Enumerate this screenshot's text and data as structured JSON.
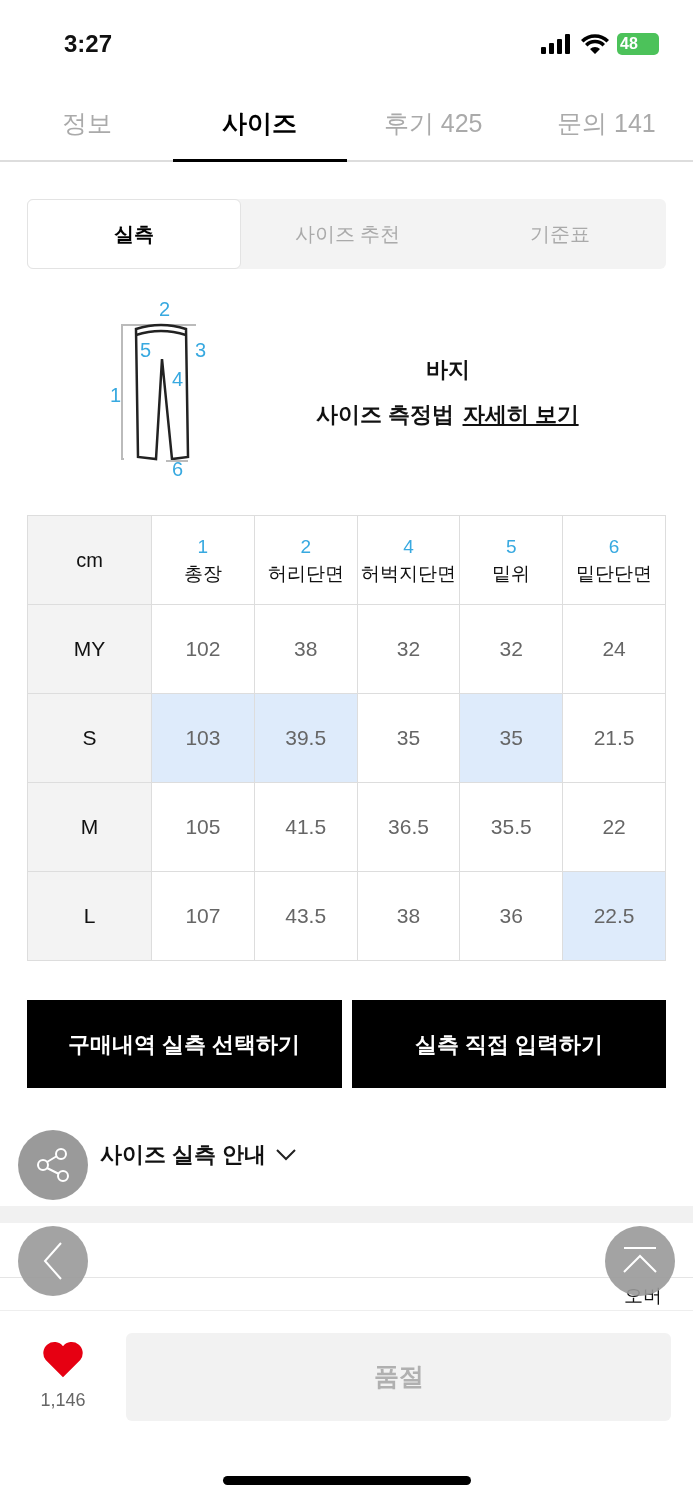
{
  "status_bar": {
    "time": "3:27",
    "battery": "48"
  },
  "tabs": [
    {
      "label": "정보",
      "selected": false
    },
    {
      "label": "사이즈",
      "selected": true
    },
    {
      "label": "후기 425",
      "selected": false
    },
    {
      "label": "문의 141",
      "selected": false
    }
  ],
  "segments": [
    {
      "label": "실측",
      "selected": true
    },
    {
      "label": "사이즈 추천",
      "selected": false
    },
    {
      "label": "기준표",
      "selected": false
    }
  ],
  "diagram": {
    "labels": [
      "1",
      "2",
      "3",
      "4",
      "5",
      "6"
    ],
    "title": "바지",
    "guide_text": "사이즈 측정법",
    "guide_link": "자세히 보기"
  },
  "size_table": {
    "unit": "cm",
    "columns": [
      {
        "number": "1",
        "name": "총장"
      },
      {
        "number": "2",
        "name": "허리단면"
      },
      {
        "number": "4",
        "name": "허벅지단면"
      },
      {
        "number": "5",
        "name": "밑위"
      },
      {
        "number": "6",
        "name": "밑단단면"
      }
    ],
    "rows": [
      {
        "size": "MY",
        "cells": [
          {
            "value": "102",
            "highlighted": false
          },
          {
            "value": "38",
            "highlighted": false
          },
          {
            "value": "32",
            "highlighted": false
          },
          {
            "value": "32",
            "highlighted": false
          },
          {
            "value": "24",
            "highlighted": false
          }
        ]
      },
      {
        "size": "S",
        "cells": [
          {
            "value": "103",
            "highlighted": true
          },
          {
            "value": "39.5",
            "highlighted": true
          },
          {
            "value": "35",
            "highlighted": false
          },
          {
            "value": "35",
            "highlighted": true
          },
          {
            "value": "21.5",
            "highlighted": false
          }
        ]
      },
      {
        "size": "M",
        "cells": [
          {
            "value": "105",
            "highlighted": false
          },
          {
            "value": "41.5",
            "highlighted": false
          },
          {
            "value": "36.5",
            "highlighted": false
          },
          {
            "value": "35.5",
            "highlighted": false
          },
          {
            "value": "22",
            "highlighted": false
          }
        ]
      },
      {
        "size": "L",
        "cells": [
          {
            "value": "107",
            "highlighted": false
          },
          {
            "value": "43.5",
            "highlighted": false
          },
          {
            "value": "38",
            "highlighted": false
          },
          {
            "value": "36",
            "highlighted": false
          },
          {
            "value": "22.5",
            "highlighted": true
          }
        ]
      }
    ]
  },
  "action_buttons": [
    "구매내역 실측 선택하기",
    "실측 직접 입력하기"
  ],
  "size_guide": {
    "title": "사이즈 실측 안내",
    "expanded": false
  },
  "next_table": {
    "column_6": "오버"
  },
  "bottom_bar": {
    "like_count": "1,146",
    "liked": true,
    "buy_button": "품절",
    "buy_disabled": true
  }
}
